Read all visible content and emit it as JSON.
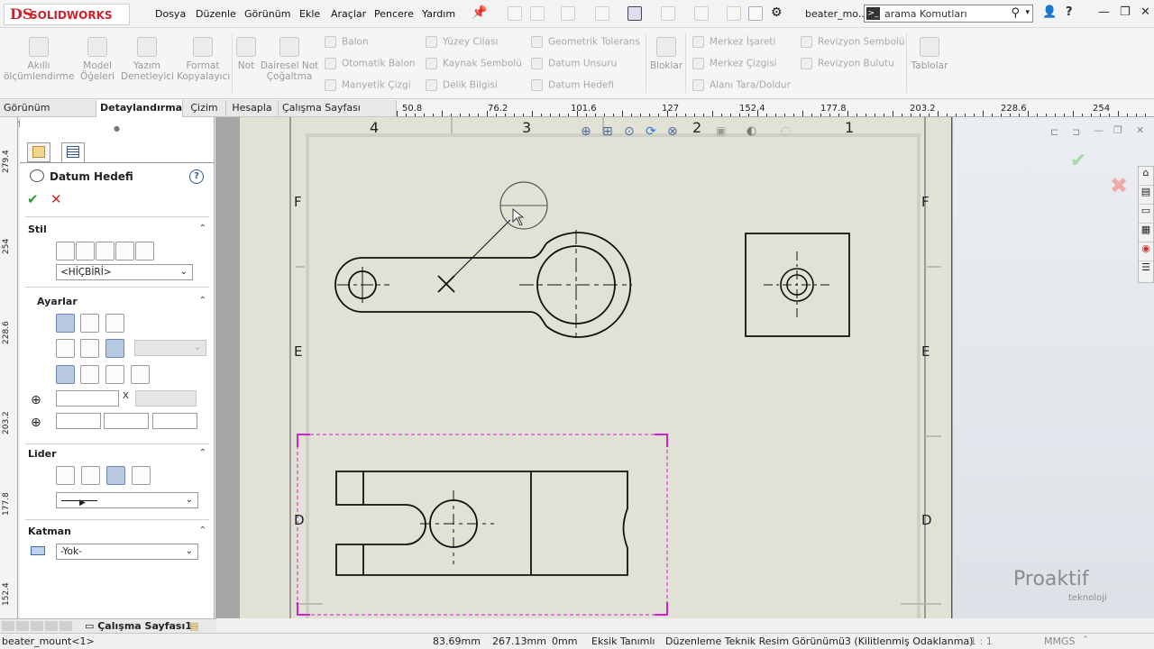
{
  "app": {
    "logo_ds": "DS",
    "logo_text": "SOLIDWORKS",
    "document_title": "beater_mo..."
  },
  "menu": [
    "Dosya",
    "Düzenle",
    "Görünüm",
    "Ekle",
    "Araçlar",
    "Pencere",
    "Yardım"
  ],
  "search": {
    "placeholder": "arama Komutları"
  },
  "window_controls": {
    "user": "👤",
    "help": "?",
    "minimize": "—",
    "restore": "❐",
    "close": "✕"
  },
  "ribbon": {
    "large": [
      {
        "label": "Akıllı\nölçümlendirme"
      },
      {
        "label": "Model\nÖğeleri"
      },
      {
        "label": "Yazım\nDenetleyici"
      },
      {
        "label": "Format\nKopyalayıcı"
      },
      {
        "label": "Not"
      },
      {
        "label": "Dairesel Not\nÇoğaltma"
      },
      {
        "label": "Bloklar"
      },
      {
        "label": "Tablolar"
      }
    ],
    "col1": [
      "Balon",
      "Otomatik Balon",
      "Manyetik Çizgi"
    ],
    "col2": [
      "Yüzey Cilası",
      "Kaynak Sembolü",
      "Delik Bilgisi"
    ],
    "col3": [
      "Geometrik Tolerans",
      "Datum Unsuru",
      "Datum Hedefi"
    ],
    "col4": [
      "Merkez İşareti",
      "Merkez Çizgisi",
      "Alanı Tara/Doldur"
    ],
    "col5": [
      "Revizyon Sembolü",
      "Revizyon Bulutu"
    ]
  },
  "tabs": [
    {
      "label": "Görünüm Yerleşimi",
      "active": false
    },
    {
      "label": "Detaylandırma",
      "active": true
    },
    {
      "label": "Çizim",
      "active": false
    },
    {
      "label": "Hesapla",
      "active": false
    },
    {
      "label": "Çalışma Sayfası Formatı",
      "active": false
    }
  ],
  "hruler": [
    "50.8",
    "76.2",
    "101.6",
    "127",
    "152.4",
    "177.8",
    "203.2",
    "228.6",
    "254"
  ],
  "vruler": [
    "279.4",
    "254",
    "228.6",
    "203.2",
    "177.8",
    "152.4"
  ],
  "property_manager": {
    "title": "Datum Hedefi",
    "help": "?",
    "ok": "✔",
    "cancel": "✕",
    "sections": {
      "stil": {
        "label": "Stil",
        "style_value": "<HİÇBİRİ>"
      },
      "ayarlar": {
        "label": "Ayarlar",
        "x_label": "X"
      },
      "lider": {
        "label": "Lider"
      },
      "katman": {
        "label": "Katman",
        "layer_value": "-Yok-"
      }
    }
  },
  "sheet": {
    "zones_top": [
      "4",
      "3",
      "2",
      "1"
    ],
    "zones_side": [
      "F",
      "E",
      "D"
    ]
  },
  "sheet_tabs": {
    "active": "Çalışma Sayfası1"
  },
  "status": {
    "model": "beater_mount<1>",
    "x": "83.69mm",
    "y": "267.13mm",
    "z": "0mm",
    "state": "Eksik Tanımlı",
    "editing": "Düzenleme Teknik Resim Görünümü3 (Kilitlenmiş Odaklanma)",
    "scale": "1 : 1",
    "units": "MMGS"
  },
  "watermark": {
    "brand": "Proaktif",
    "sub": "teknoloji"
  },
  "colors": {
    "accent_red": "#d1202a",
    "selection_magenta": "#d11fd1",
    "sheet_bg": "#e2e1d6"
  }
}
